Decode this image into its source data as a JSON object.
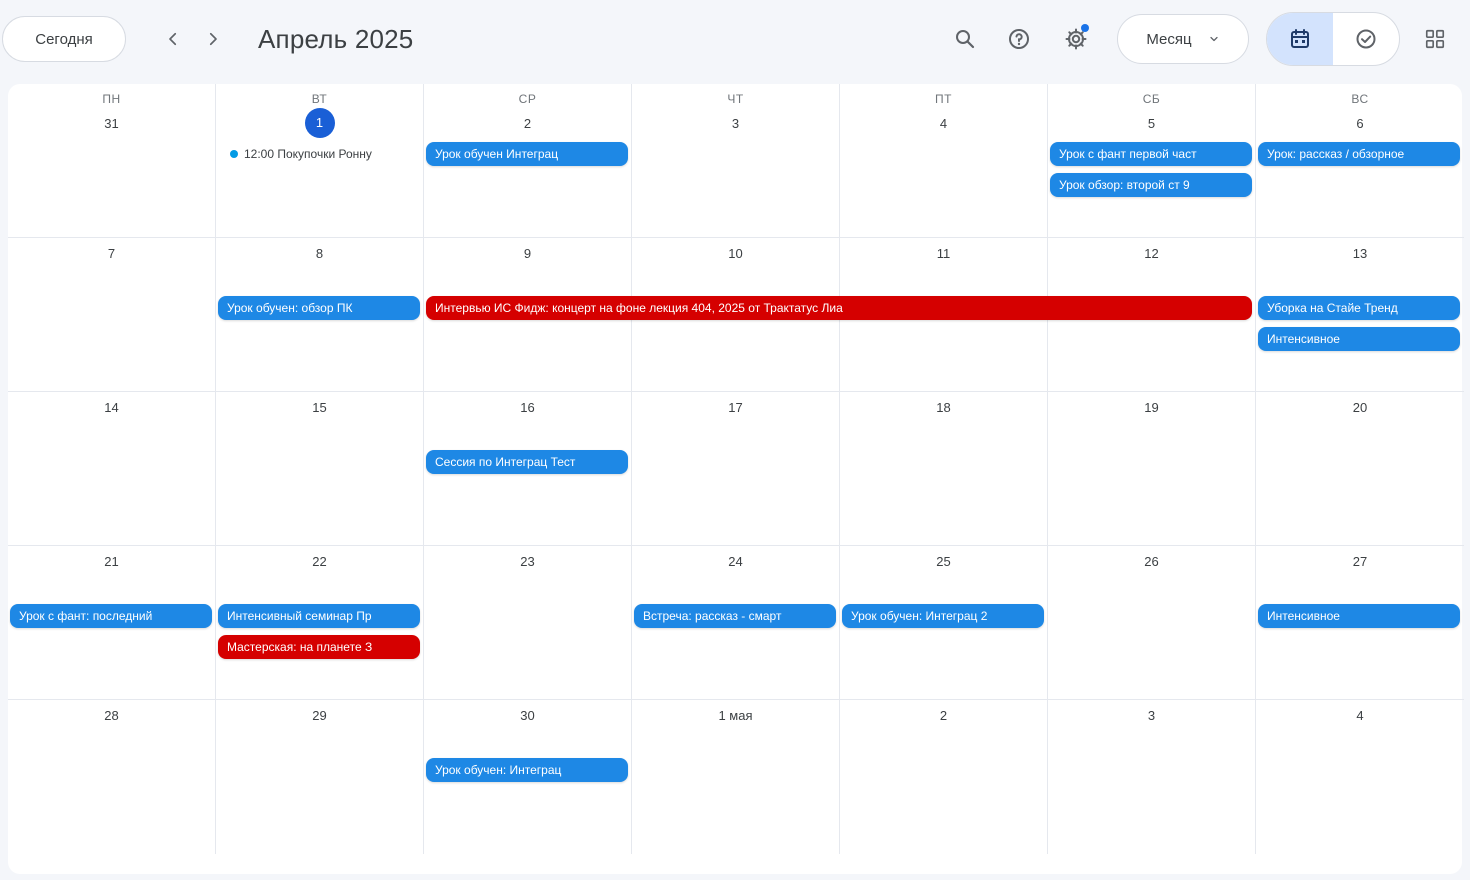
{
  "toolbar": {
    "today_label": "Сегодня",
    "prev_icon": "chevron-left-icon",
    "next_icon": "chevron-right-icon",
    "month_title": "Апрель 2025",
    "search_icon": "search-icon",
    "help_icon": "help-icon",
    "settings_icon": "settings-icon",
    "view_label": "Месяц",
    "calendar_view_icon": "calendar-icon",
    "tasks_view_icon": "check-circle-icon",
    "apps_icon": "apps-grid-icon"
  },
  "colors": {
    "accent": "#1a5fd6",
    "event_blue": "#1e88e5",
    "event_red": "#d50000",
    "toggle_active": "#d3e3fd"
  },
  "weekdays": [
    "ПН",
    "ВТ",
    "СР",
    "ЧТ",
    "ПТ",
    "СБ",
    "ВС"
  ],
  "weeks": [
    [
      "31",
      "1",
      "2",
      "3",
      "4",
      "5",
      "6"
    ],
    [
      "7",
      "8",
      "9",
      "10",
      "11",
      "12",
      "13"
    ],
    [
      "14",
      "15",
      "16",
      "17",
      "18",
      "19",
      "20"
    ],
    [
      "21",
      "22",
      "23",
      "24",
      "25",
      "26",
      "27"
    ],
    [
      "28",
      "29",
      "30",
      "1 мая",
      "2",
      "3",
      "4"
    ]
  ],
  "today": {
    "week": 0,
    "day": 1
  },
  "events": [
    {
      "week": 0,
      "day": 1,
      "slot": 0,
      "span": 1,
      "kind": "dot",
      "color": "blue",
      "text": "12:00 Покупочки Ронну"
    },
    {
      "week": 0,
      "day": 2,
      "slot": 0,
      "span": 1,
      "kind": "bar",
      "color": "blue",
      "text": "Урок обучен Интеграц"
    },
    {
      "week": 0,
      "day": 5,
      "slot": 0,
      "span": 1,
      "kind": "bar",
      "color": "blue",
      "text": "Урок с фант первой част"
    },
    {
      "week": 0,
      "day": 5,
      "slot": 1,
      "span": 1,
      "kind": "bar",
      "color": "blue",
      "text": "Урок обзор: второй ст 9"
    },
    {
      "week": 0,
      "day": 6,
      "slot": 0,
      "span": 1,
      "kind": "bar",
      "color": "blue",
      "text": "Урок: рассказ / обзорное"
    },
    {
      "week": 1,
      "day": 1,
      "slot": 0,
      "span": 1,
      "kind": "bar",
      "color": "blue",
      "text": "Урок обучен: обзор ПК"
    },
    {
      "week": 1,
      "day": 2,
      "slot": 0,
      "span": 4,
      "kind": "bar",
      "color": "red",
      "text": "Интервью ИС Фидж: концерт на фоне лекция 404, 2025 от Трактатус Лиа"
    },
    {
      "week": 1,
      "day": 6,
      "slot": 0,
      "span": 1,
      "kind": "bar",
      "color": "blue",
      "text": "Уборка на Стайе Тренд"
    },
    {
      "week": 1,
      "day": 6,
      "slot": 1,
      "span": 1,
      "kind": "bar",
      "color": "blue",
      "text": "Интенсивное"
    },
    {
      "week": 2,
      "day": 2,
      "slot": 0,
      "span": 1,
      "kind": "bar",
      "color": "blue",
      "text": "Сессия по Интеграц Тест"
    },
    {
      "week": 3,
      "day": 0,
      "slot": 0,
      "span": 1,
      "kind": "bar",
      "color": "blue",
      "text": "Урок с фант: последний"
    },
    {
      "week": 3,
      "day": 1,
      "slot": 0,
      "span": 1,
      "kind": "bar",
      "color": "blue",
      "text": "Интенсивный семинар Пр"
    },
    {
      "week": 3,
      "day": 1,
      "slot": 1,
      "span": 1,
      "kind": "bar",
      "color": "red",
      "text": "Мастерская: на планете З"
    },
    {
      "week": 3,
      "day": 3,
      "slot": 0,
      "span": 1,
      "kind": "bar",
      "color": "blue",
      "text": "Встреча: рассказ - смарт"
    },
    {
      "week": 3,
      "day": 4,
      "slot": 0,
      "span": 1,
      "kind": "bar",
      "color": "blue",
      "text": "Урок обучен: Интеграц 2"
    },
    {
      "week": 3,
      "day": 6,
      "slot": 0,
      "span": 1,
      "kind": "bar",
      "color": "blue",
      "text": "Интенсивное"
    },
    {
      "week": 4,
      "day": 2,
      "slot": 0,
      "span": 1,
      "kind": "bar",
      "color": "blue",
      "text": "Урок обучен: Интеграц"
    }
  ]
}
